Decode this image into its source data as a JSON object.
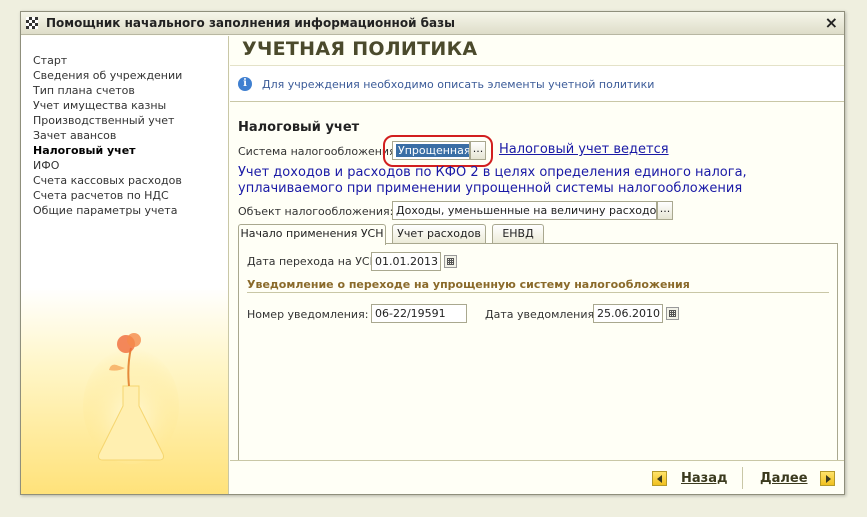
{
  "window": {
    "title": "Помощник начального заполнения информационной базы",
    "close_icon": "×"
  },
  "sidebar": {
    "items": [
      {
        "label": "Старт",
        "active": false
      },
      {
        "label": "Сведения об учреждении",
        "active": false
      },
      {
        "label": "Тип плана счетов",
        "active": false
      },
      {
        "label": "Учет имущества казны",
        "active": false
      },
      {
        "label": "Производственный учет",
        "active": false
      },
      {
        "label": "Зачет авансов",
        "active": false
      },
      {
        "label": "Налоговый учет",
        "active": true
      },
      {
        "label": "ИФО",
        "active": false
      },
      {
        "label": "Счета кассовых расходов",
        "active": false
      },
      {
        "label": "Счета расчетов по НДС",
        "active": false
      },
      {
        "label": "Общие параметры учета",
        "active": false
      }
    ]
  },
  "main": {
    "page_title": "УЧЕТНАЯ ПОЛИТИКА",
    "info_icon": "i",
    "info_text": "Для учреждения необходимо описать элементы учетной политики",
    "section_title": "Налоговый учет",
    "tax_system": {
      "label": "Система налогообложения:",
      "value": "Упрощенная",
      "button": "...",
      "status_link": "Налоговый учет ведется"
    },
    "description": "Учет доходов и расходов по КФО 2 в целях определения единого налога, уплачиваемого при применении упрощенной системы налогообложения",
    "tax_object": {
      "label": "Объект налогообложения:",
      "value": "Доходы, уменьшенные на величину расходов",
      "button": "..."
    },
    "tabs": [
      {
        "label": "Начало применения УСН",
        "active": true
      },
      {
        "label": "Учет расходов",
        "active": false
      },
      {
        "label": "ЕНВД",
        "active": false
      }
    ],
    "usn_tab": {
      "transition_date_label": "Дата перехода на УСН:",
      "transition_date": "01.01.2013",
      "notice_title": "Уведомление о переходе на упрощенную систему налогообложения",
      "notice_number_label": "Номер уведомления:",
      "notice_number": "06-22/19591",
      "notice_date_label": "Дата уведомления:",
      "notice_date": "25.06.2010"
    }
  },
  "footer": {
    "back_label": "Назад",
    "next_label": "Далее"
  },
  "colors": {
    "accent_link": "#1a1aa6",
    "highlight": "#d21f1f",
    "subheading": "#8a6a2a"
  }
}
